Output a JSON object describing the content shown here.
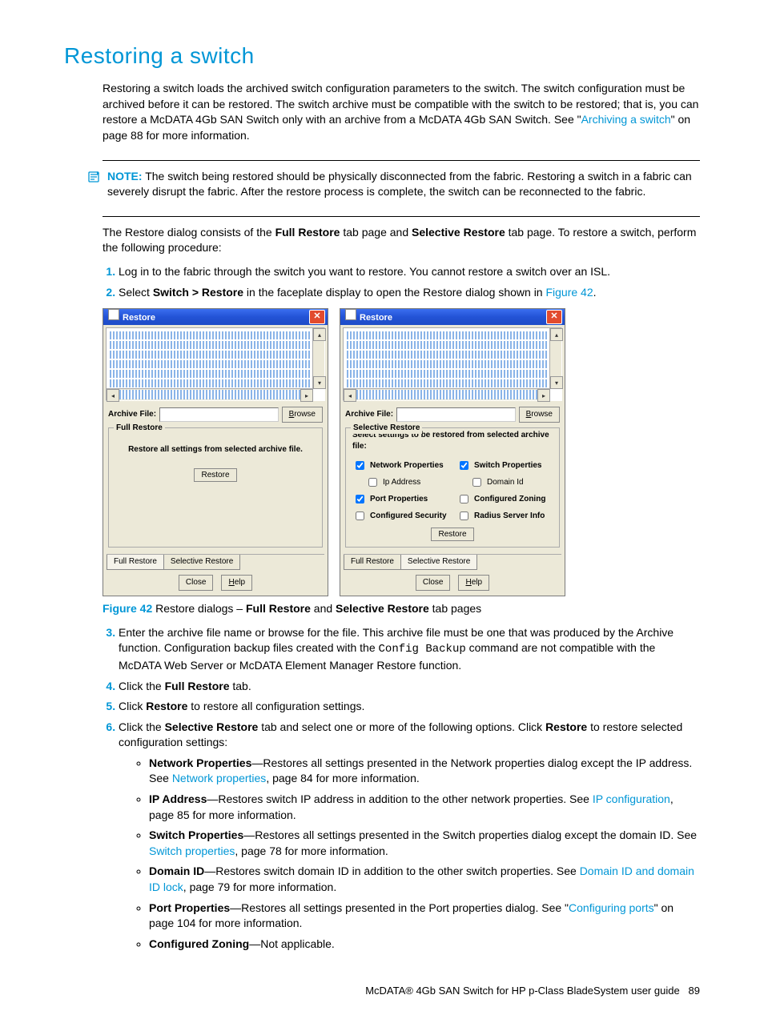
{
  "heading": "Restoring a switch",
  "intro": {
    "t1": "Restoring a switch loads the archived switch configuration parameters to the switch. The switch configuration must be archived before it can be restored. The switch archive must be compatible with the switch to be restored; that is, you can restore a McDATA 4Gb SAN Switch only with an archive from a McDATA 4Gb SAN Switch. See \"",
    "link": "Archiving a switch",
    "t2": "\" on page 88 for more information."
  },
  "note": {
    "label": "NOTE:",
    "text": "The switch being restored should be physically disconnected from the fabric. Restoring a switch in a fabric can severely disrupt the fabric. After the restore process is complete, the switch can be reconnected to the fabric."
  },
  "para2": {
    "a": "The Restore dialog consists of the ",
    "b": "Full Restore",
    "c": " tab page and ",
    "d": "Selective Restore",
    "e": " tab page. To restore a switch, perform the following procedure:"
  },
  "steps": {
    "s1": "Log in to the fabric through the switch you want to restore. You cannot restore a switch over an ISL.",
    "s2a": "Select ",
    "s2b": "Switch > Restore",
    "s2c": " in the faceplate display to open the Restore dialog shown in ",
    "s2link": "Figure 42",
    "s2d": ".",
    "s3a": "Enter the archive file name or browse for the file. This archive file must be one that was produced by the Archive function. Configuration backup files created with the ",
    "s3cmd": "Config Backup",
    "s3b": " command are not compatible with the McDATA Web Server or McDATA Element Manager Restore function.",
    "s4a": "Click the ",
    "s4b": "Full Restore",
    "s4c": " tab.",
    "s5a": "Click ",
    "s5b": "Restore",
    "s5c": " to restore all configuration settings.",
    "s6a": "Click the ",
    "s6b": "Selective Restore",
    "s6c": " tab and select one or more of the following options. Click ",
    "s6d": "Restore",
    "s6e": " to restore selected configuration settings:"
  },
  "bullets": {
    "b1": {
      "h": "Network Properties",
      "t1": "—Restores all settings presented in the Network properties dialog except the IP address. See ",
      "link": "Network properties",
      "t2": ", page 84 for more information."
    },
    "b2": {
      "h": "IP Address",
      "t1": "—Restores switch IP address in addition to the other network properties. See ",
      "link": "IP configuration",
      "t2": ", page 85 for more information."
    },
    "b3": {
      "h": "Switch Properties",
      "t1": "—Restores all settings presented in the Switch properties dialog except the domain ID. See ",
      "link": "Switch properties",
      "t2": ", page 78 for more information."
    },
    "b4": {
      "h": "Domain ID",
      "t1": "—Restores switch domain ID in addition to the other switch properties. See ",
      "link": "Domain ID and domain ID lock",
      "t2": ", page 79 for more information."
    },
    "b5": {
      "h": "Port Properties",
      "t1": "—Restores all settings presented in the Port properties dialog. See \"",
      "link": "Configuring ports",
      "t2": "\" on page 104 for more information."
    },
    "b6": {
      "h": "Configured Zoning",
      "t1": "—Not applicable."
    }
  },
  "dialog": {
    "title": "Restore",
    "archive_label": "Archive File:",
    "browse": "Browse",
    "full_legend": "Full Restore",
    "full_msg": "Restore all settings from selected archive file.",
    "restore_btn": "Restore",
    "tab_full": "Full Restore",
    "tab_sel": "Selective Restore",
    "close": "Close",
    "help": "Help",
    "sel_legend": "Selective Restore",
    "sel_msg": "Select settings to be restored from selected archive file:",
    "opts": {
      "net": "Network Properties",
      "ip": "Ip Address",
      "port": "Port Properties",
      "sec": "Configured Security",
      "sw": "Switch Properties",
      "dom": "Domain Id",
      "zone": "Configured Zoning",
      "rad": "Radius Server Info"
    }
  },
  "figcap": {
    "label": "Figure 42",
    "a": " Restore dialogs – ",
    "b": "Full Restore",
    "c": " and ",
    "d": "Selective Restore",
    "e": " tab pages"
  },
  "footer": {
    "title": "McDATA® 4Gb SAN Switch for HP p-Class BladeSystem user guide",
    "page": "89"
  }
}
